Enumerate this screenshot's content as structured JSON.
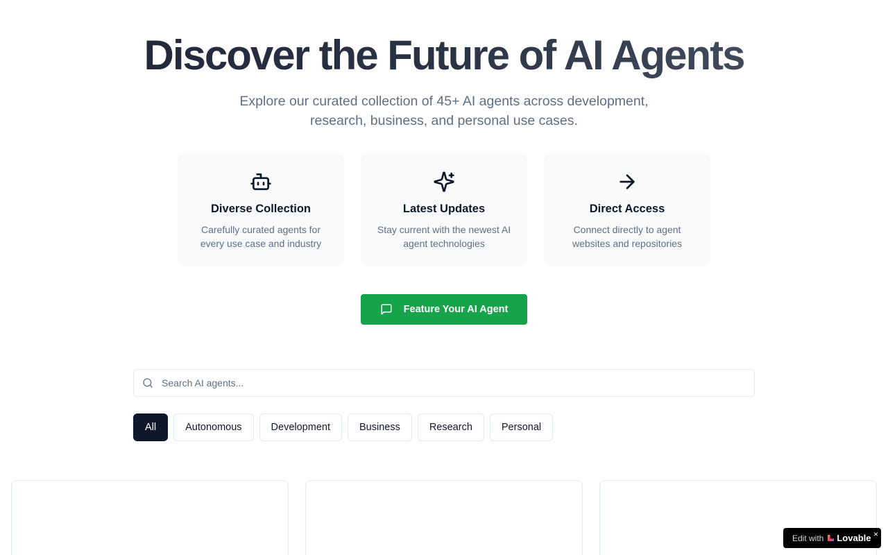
{
  "hero": {
    "title": "Discover the Future of AI Agents",
    "subtitle": "Explore our curated collection of 45+ AI agents across development, research, business, and personal use cases."
  },
  "features": [
    {
      "icon": "bot-icon",
      "title": "Diverse Collection",
      "description": "Carefully curated agents for every use case and industry"
    },
    {
      "icon": "sparkles-icon",
      "title": "Latest Updates",
      "description": "Stay current with the newest AI agent technologies"
    },
    {
      "icon": "arrow-right-icon",
      "title": "Direct Access",
      "description": "Connect directly to agent websites and repositories"
    }
  ],
  "cta": {
    "label": "Feature Your AI Agent",
    "icon": "message-square-icon",
    "color": "#16a34a"
  },
  "search": {
    "placeholder": "Search AI agents...",
    "value": ""
  },
  "filters": {
    "selected": "All",
    "options": [
      "All",
      "Autonomous",
      "Development",
      "Business",
      "Research",
      "Personal"
    ]
  },
  "badge": {
    "prefix": "Edit with",
    "brand": "Lovable",
    "close": "×"
  },
  "colors": {
    "text_primary": "#0f172a",
    "text_muted": "#5f6f86",
    "accent_green": "#16a34a",
    "chip_active": "#0f172a"
  }
}
